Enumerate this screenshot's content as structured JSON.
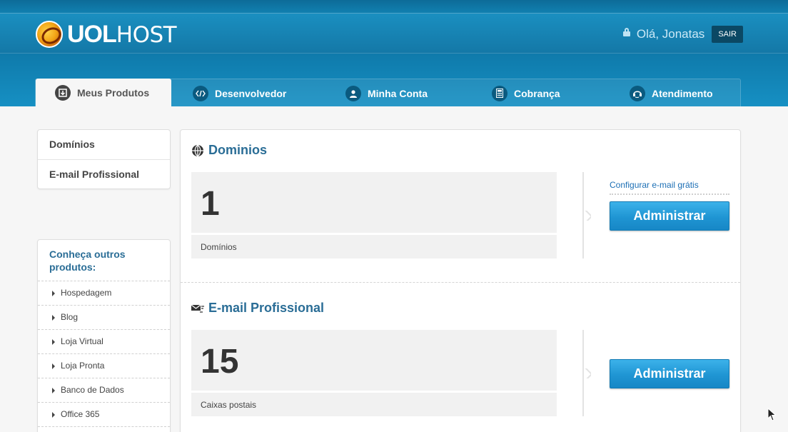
{
  "header": {
    "logo": {
      "brand_bold": "UOL",
      "brand_light": "HOST"
    },
    "greeting": "Olá, Jonatas",
    "logout_label": "SAIR",
    "colors": {
      "bar": "#1478a7",
      "accent": "#2a6d96"
    }
  },
  "tabs": [
    {
      "label": "Meus Produtos",
      "icon": "download-box-icon",
      "active": true
    },
    {
      "label": "Desenvolvedor",
      "icon": "code-icon",
      "active": false
    },
    {
      "label": "Minha Conta",
      "icon": "user-icon",
      "active": false
    },
    {
      "label": "Cobrança",
      "icon": "calculator-icon",
      "active": false
    },
    {
      "label": "Atendimento",
      "icon": "headset-icon",
      "active": false
    }
  ],
  "sidebar": {
    "items": [
      {
        "label": "Domínios"
      },
      {
        "label": "E-mail Profissional"
      }
    ],
    "products": {
      "title": "Conheça outros produtos:",
      "items": [
        "Hospedagem",
        "Blog",
        "Loja Virtual",
        "Loja Pronta",
        "Banco de Dados",
        "Office 365"
      ]
    }
  },
  "main": {
    "sections": [
      {
        "title": "Dominios",
        "icon": "globe-icon",
        "count": "1",
        "count_label": "Domínios",
        "link": "Configurar e-mail grátis",
        "button": "Administrar"
      },
      {
        "title": "E-mail Profissional",
        "icon": "mail-icon",
        "count": "15",
        "count_label": "Caixas postais",
        "button": "Administrar"
      }
    ]
  }
}
